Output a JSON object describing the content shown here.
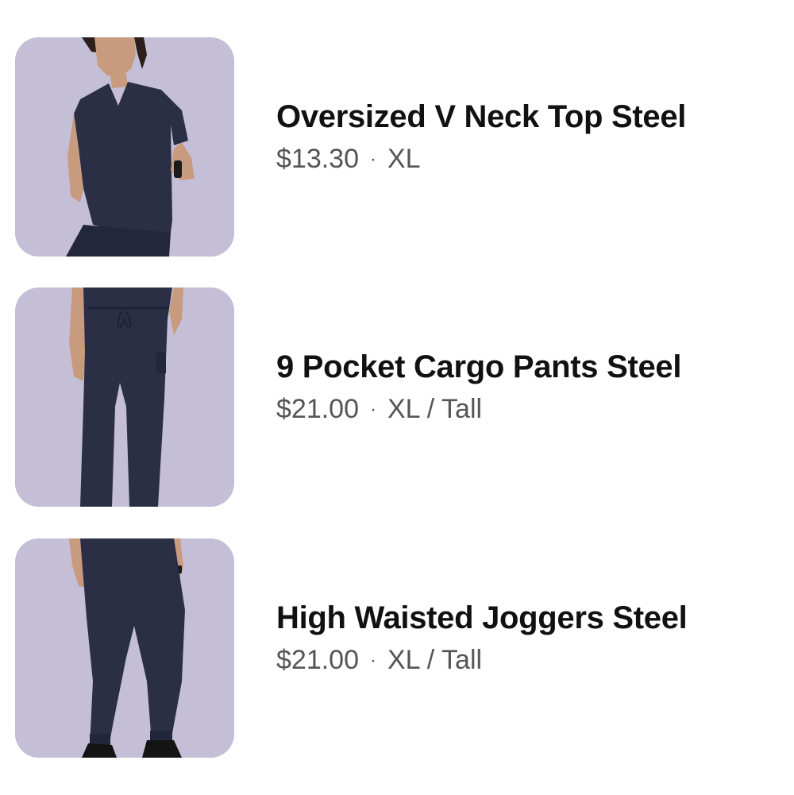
{
  "cart": {
    "items": [
      {
        "title": "Oversized V Neck Top Steel",
        "price": "$13.30",
        "separator": "·",
        "variant": "XL",
        "image": "product-photo-top"
      },
      {
        "title": "9 Pocket Cargo Pants Steel",
        "price": "$21.00",
        "separator": "·",
        "variant": "XL / Tall",
        "image": "product-photo-cargo-pants"
      },
      {
        "title": "High Waisted Joggers Steel",
        "price": "$21.00",
        "separator": "·",
        "variant": "XL / Tall",
        "image": "product-photo-joggers"
      }
    ],
    "colors": {
      "thumb_background": "#c4bfd6",
      "garment": "#2b2f45",
      "skin": "#c89a7e",
      "title_text": "#111111",
      "meta_text": "#555555"
    }
  }
}
